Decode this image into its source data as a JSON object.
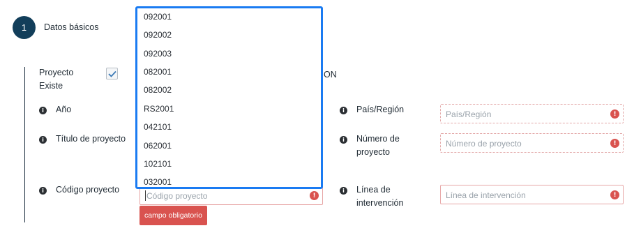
{
  "step": {
    "number": "1",
    "title": "Datos básicos"
  },
  "fields": {
    "proyecto_existe": {
      "label_line1": "Proyecto",
      "label_line2": "Existe",
      "checked": true,
      "partial_text": "ON"
    },
    "anio": {
      "label": "Año"
    },
    "titulo": {
      "label": "Título de proyecto"
    },
    "codigo": {
      "label": "Código proyecto",
      "placeholder": "Código proyecto",
      "error": "campo obligatorio"
    },
    "pais": {
      "label": "País/Región",
      "placeholder": "País/Región"
    },
    "numero": {
      "label_line1": "Número de",
      "label_line2": "proyecto",
      "placeholder": "Número de proyecto"
    },
    "linea": {
      "label_line1": "Línea de",
      "label_line2": "intervención",
      "placeholder": "Línea de intervención"
    }
  },
  "dropdown": {
    "options": [
      "092001",
      "092002",
      "092003",
      "082001",
      "082002",
      "RS2001",
      "042101",
      "062001",
      "102101",
      "032001"
    ]
  },
  "icons": {
    "info": "info-icon",
    "error": "exclamation-icon",
    "check": "check-icon"
  },
  "colors": {
    "accent": "#1a7bf2",
    "error": "#d9534f",
    "step": "#123e5a"
  }
}
